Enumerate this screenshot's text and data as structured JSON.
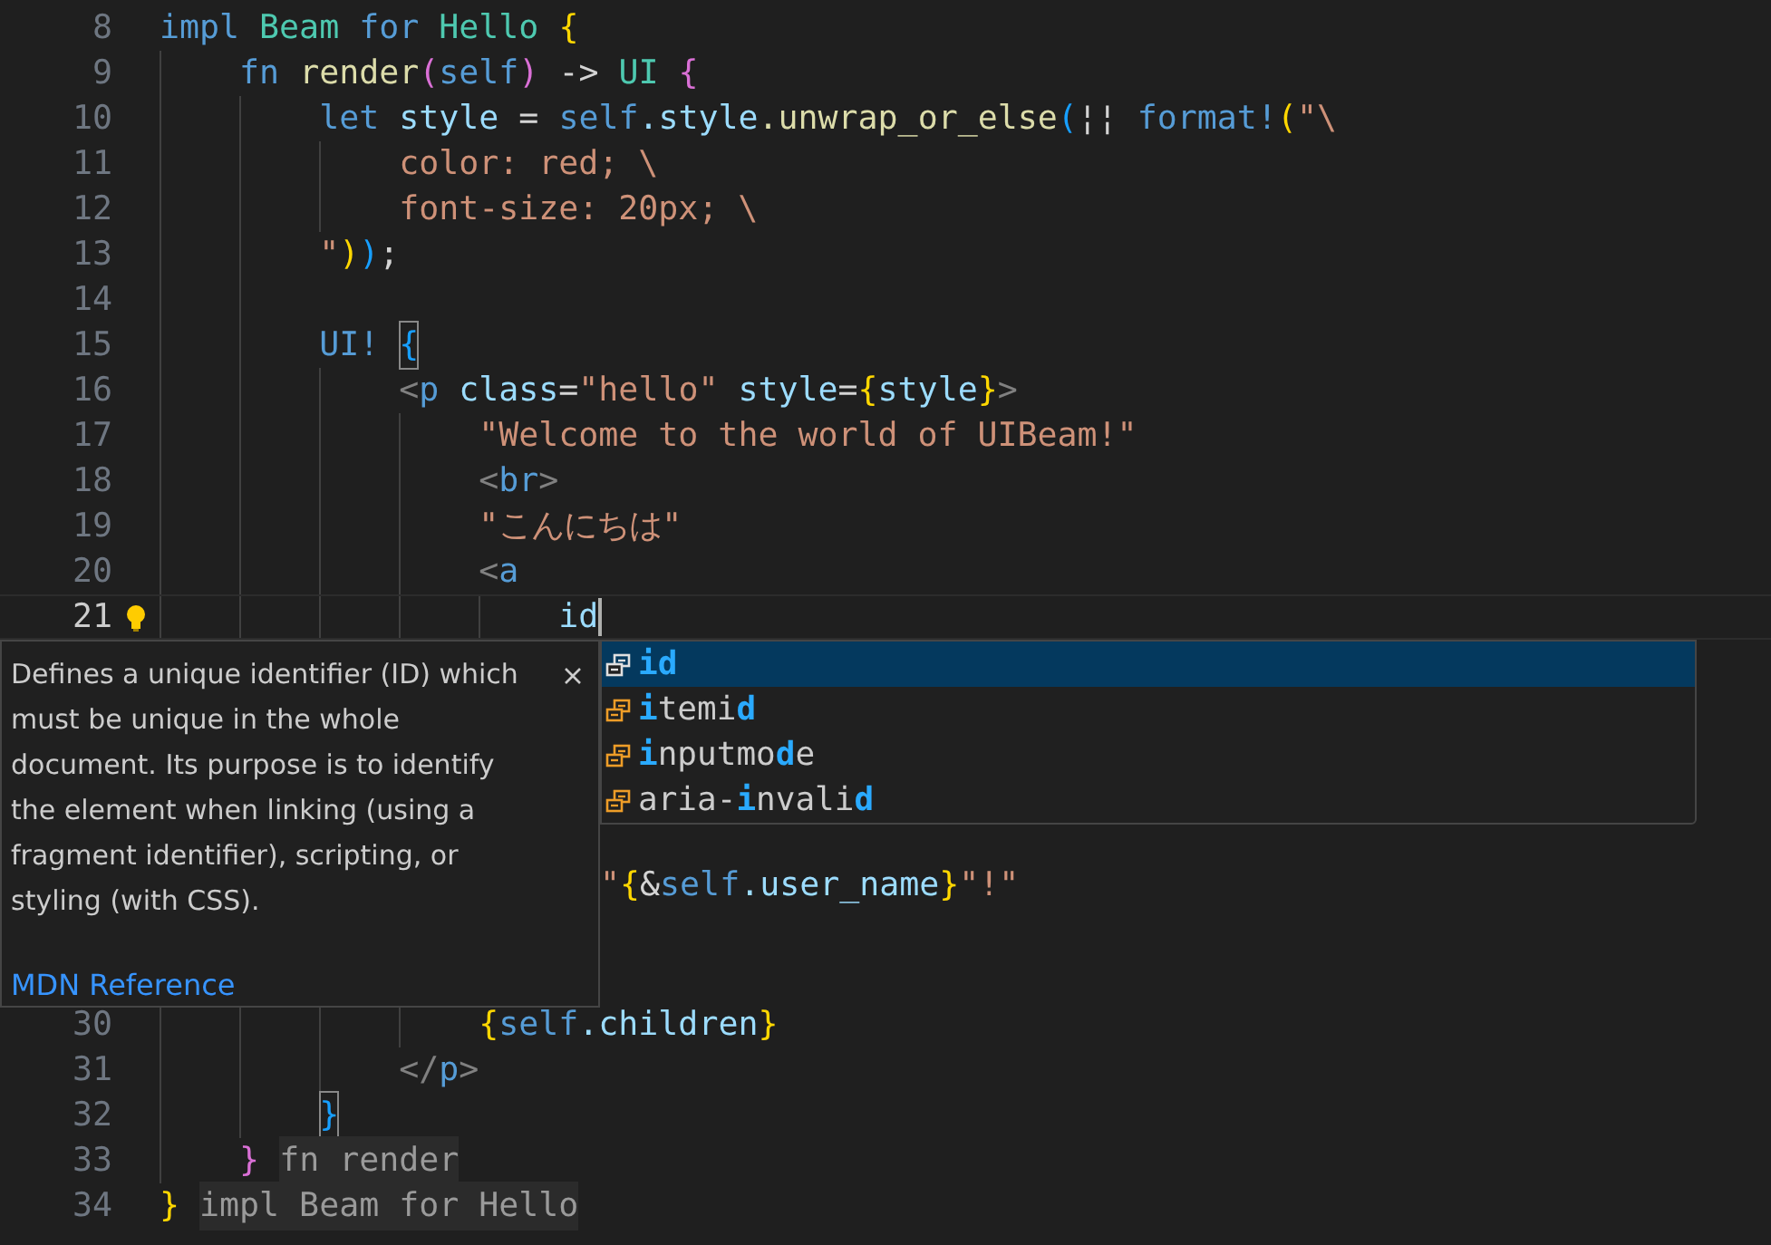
{
  "editor": {
    "lines": [
      {
        "number": "8",
        "tokens": [
          {
            "text": "impl ",
            "kind": "keyword"
          },
          {
            "text": "Beam ",
            "kind": "type"
          },
          {
            "text": "for ",
            "kind": "keyword"
          },
          {
            "text": "Hello ",
            "kind": "type"
          },
          {
            "text": "{",
            "kind": "bracket1"
          }
        ]
      },
      {
        "number": "9",
        "tokens": [
          {
            "text": "    fn ",
            "kind": "keyword"
          },
          {
            "text": "render",
            "kind": "function"
          },
          {
            "text": "(",
            "kind": "bracket2"
          },
          {
            "text": "self",
            "kind": "keyword"
          },
          {
            "text": ")",
            "kind": "bracket2"
          },
          {
            "text": " -> ",
            "kind": "plain"
          },
          {
            "text": "UI ",
            "kind": "type"
          },
          {
            "text": "{",
            "kind": "bracket2"
          }
        ]
      },
      {
        "number": "10",
        "tokens": [
          {
            "text": "        let ",
            "kind": "keyword"
          },
          {
            "text": "style",
            "kind": "variable"
          },
          {
            "text": " = ",
            "kind": "plain"
          },
          {
            "text": "self",
            "kind": "keyword"
          },
          {
            "text": ".style",
            "kind": "variable"
          },
          {
            "text": ".unwrap_or_else",
            "kind": "function"
          },
          {
            "text": "(",
            "kind": "bracket3"
          },
          {
            "text": "¦¦ ",
            "kind": "plain"
          },
          {
            "text": "format!",
            "kind": "keyword"
          },
          {
            "text": "(",
            "kind": "bracket1"
          },
          {
            "text": "\"\\",
            "kind": "string"
          }
        ]
      },
      {
        "number": "11",
        "tokens": [
          {
            "text": "            color: red; \\",
            "kind": "string"
          }
        ]
      },
      {
        "number": "12",
        "tokens": [
          {
            "text": "            font-size: 20px; \\",
            "kind": "string"
          }
        ]
      },
      {
        "number": "13",
        "tokens": [
          {
            "text": "        \"",
            "kind": "string"
          },
          {
            "text": ")",
            "kind": "bracket1"
          },
          {
            "text": ")",
            "kind": "bracket3"
          },
          {
            "text": ";",
            "kind": "plain"
          }
        ]
      },
      {
        "number": "14"
      },
      {
        "number": "15",
        "tokens": [
          {
            "text": "        UI! ",
            "kind": "keyword"
          },
          {
            "text": "{",
            "kind": "bracket3-match"
          }
        ]
      },
      {
        "number": "16",
        "tokens": [
          {
            "text": "            <",
            "kind": "punct"
          },
          {
            "text": "p ",
            "kind": "tag"
          },
          {
            "text": "class",
            "kind": "variable"
          },
          {
            "text": "=",
            "kind": "plain"
          },
          {
            "text": "\"hello\" ",
            "kind": "string"
          },
          {
            "text": "style",
            "kind": "variable"
          },
          {
            "text": "=",
            "kind": "plain"
          },
          {
            "text": "{",
            "kind": "bracket1"
          },
          {
            "text": "style",
            "kind": "variable"
          },
          {
            "text": "}",
            "kind": "bracket1"
          },
          {
            "text": ">",
            "kind": "punct"
          }
        ]
      },
      {
        "number": "17",
        "tokens": [
          {
            "text": "                \"Welcome to the world of UIBeam!\"",
            "kind": "string"
          }
        ]
      },
      {
        "number": "18",
        "tokens": [
          {
            "text": "                <",
            "kind": "punct"
          },
          {
            "text": "br",
            "kind": "tag"
          },
          {
            "text": ">",
            "kind": "punct"
          }
        ]
      },
      {
        "number": "19",
        "tokens": [
          {
            "text": "                \"こんにちは\"",
            "kind": "string"
          }
        ]
      },
      {
        "number": "20",
        "tokens": [
          {
            "text": "                <",
            "kind": "punct"
          },
          {
            "text": "a",
            "kind": "tag"
          }
        ]
      },
      {
        "number": "21",
        "current": true,
        "tokens": [
          {
            "text": "                    id",
            "kind": "variable"
          }
        ]
      },
      {
        "number": "30",
        "tokens": [
          {
            "text": "                {",
            "kind": "bracket1"
          },
          {
            "text": "self",
            "kind": "keyword"
          },
          {
            "text": ".children",
            "kind": "variable"
          },
          {
            "text": "}",
            "kind": "bracket1"
          }
        ]
      },
      {
        "number": "31",
        "tokens": [
          {
            "text": "            </",
            "kind": "punct"
          },
          {
            "text": "p",
            "kind": "tag"
          },
          {
            "text": ">",
            "kind": "punct"
          }
        ]
      },
      {
        "number": "32",
        "tokens": [
          {
            "text": "        }",
            "kind": "bracket3-match"
          }
        ]
      },
      {
        "number": "33",
        "tokens": [
          {
            "text": "    } ",
            "kind": "bracket2"
          },
          {
            "text": "fn render",
            "kind": "hint"
          }
        ]
      },
      {
        "number": "34",
        "tokens": [
          {
            "text": "} ",
            "kind": "bracket1"
          },
          {
            "text": "impl Beam for Hello",
            "kind": "hint"
          }
        ]
      }
    ],
    "partial_line": {
      "tokens": [
        {
          "text": "\"",
          "kind": "string"
        },
        {
          "text": "{",
          "kind": "bracket1"
        },
        {
          "text": "&",
          "kind": "plain"
        },
        {
          "text": "self",
          "kind": "keyword"
        },
        {
          "text": ".user_name",
          "kind": "variable"
        },
        {
          "text": "}",
          "kind": "bracket1"
        },
        {
          "text": "\"!\"",
          "kind": "string"
        }
      ]
    }
  },
  "suggestions": [
    {
      "label": "**id**",
      "selected": true
    },
    {
      "label": "**i**temi**d**",
      "selected": false
    },
    {
      "label": "**i**nputmo**d**e",
      "selected": false
    },
    {
      "label": "aria-**i**nvali**d**",
      "selected": false
    }
  ],
  "details": {
    "description": "Defines a unique identifier (ID) which must be unique in the whole document. Its purpose is to identify the element when linking (using a fragment identifier), scripting, or styling (with CSS).",
    "link": "MDN Reference"
  }
}
